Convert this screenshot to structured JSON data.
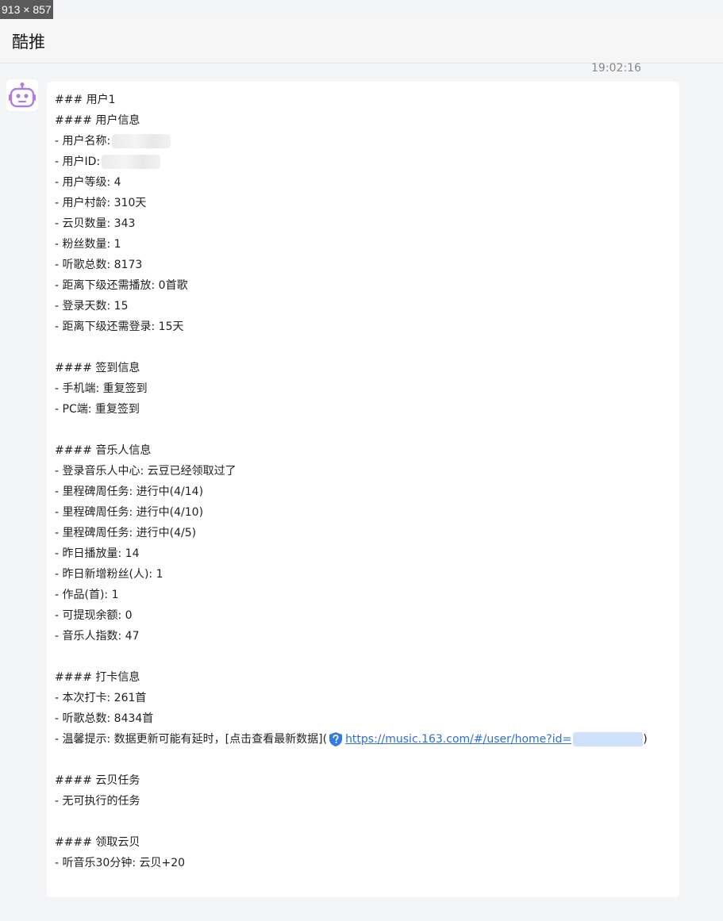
{
  "screen_size_label": "913 × 857",
  "header": {
    "title": "酷推"
  },
  "message": {
    "timestamp": "19:02:16",
    "lines": [
      "### 用户1",
      "#### 用户信息",
      "- 用户名称:",
      "- 用户ID:",
      "- 用户等级: 4",
      "- 用户村龄: 310天",
      "- 云贝数量: 343",
      "- 粉丝数量: 1",
      "- 听歌总数: 8173",
      "- 距离下级还需播放: 0首歌",
      "- 登录天数: 15",
      "- 距离下级还需登录: 15天",
      "",
      "#### 签到信息",
      "- 手机端: 重复签到",
      "- PC端: 重复签到",
      "",
      "#### 音乐人信息",
      "- 登录音乐人中心: 云豆已经领取过了",
      "- 里程碑周任务: 进行中(4/14)",
      "- 里程碑周任务: 进行中(4/10)",
      "- 里程碑周任务: 进行中(4/5)",
      "- 昨日播放量: 14",
      "- 昨日新增粉丝(人): 1",
      "- 作品(首): 1",
      "- 可提现余额: 0",
      "- 音乐人指数: 47",
      "",
      "#### 打卡信息",
      "- 本次打卡: 261首",
      "- 听歌总数: 8434首",
      "- 温馨提示: 数据更新可能有延时，[点击查看最新数据](",
      "",
      "#### 云贝任务",
      "- 无可执行的任务",
      "",
      "#### 领取云贝",
      "- 听音乐30分钟: 云贝+20"
    ],
    "link": {
      "url_text": "https://music.163.com/#/user/home?id=",
      "closing": ")"
    }
  },
  "icons": {
    "avatar": "robot-icon",
    "link_badge": "shield-question-icon"
  },
  "colors": {
    "link": "#2f6ed8",
    "avatar": "#b07ce0",
    "badge": "#2f7de1"
  }
}
